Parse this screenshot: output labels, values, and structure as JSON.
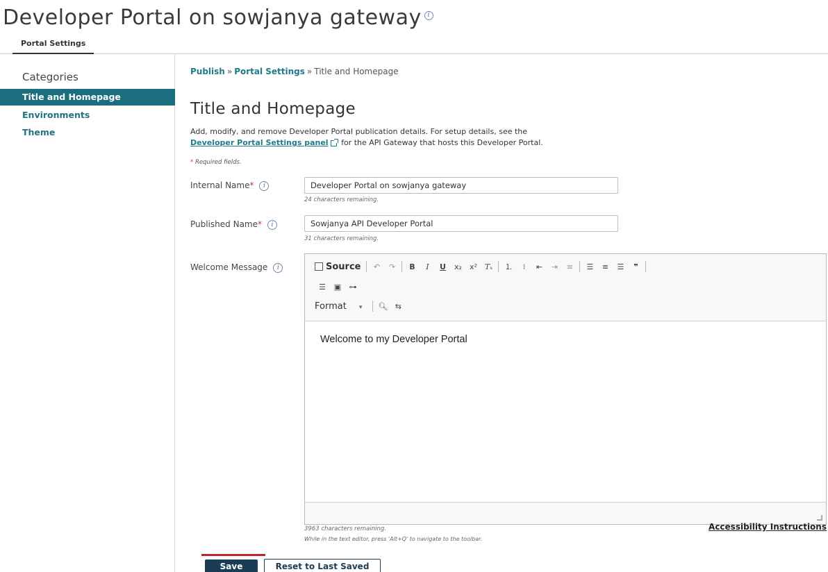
{
  "page": {
    "title": "Developer Portal on sowjanya gateway",
    "info_icon": "i"
  },
  "tabs": [
    {
      "label": "Portal Settings",
      "active": true
    }
  ],
  "sidebar": {
    "heading": "Categories",
    "items": [
      {
        "label": "Title and Homepage",
        "active": true
      },
      {
        "label": "Environments",
        "active": false
      },
      {
        "label": "Theme",
        "active": false
      }
    ]
  },
  "breadcrumb": {
    "items": [
      "Publish",
      "Portal Settings"
    ],
    "current": "Title and Homepage",
    "separator": "»"
  },
  "section": {
    "title": "Title and Homepage",
    "desc_part1": "Add, modify, and remove Developer Portal publication details. For setup details, see the",
    "desc_link": "Developer Portal Settings panel",
    "desc_part2": "for the API Gateway that hosts this Developer Portal.",
    "required_note": "Required fields."
  },
  "form": {
    "internal_name": {
      "label": "Internal Name",
      "value": "Developer Portal on sowjanya gateway",
      "hint": "24 characters remaining."
    },
    "published_name": {
      "label": "Published Name",
      "value": "Sowjanya API Developer Portal",
      "hint": "31 characters remaining."
    },
    "welcome_message": {
      "label": "Welcome Message",
      "content": "Welcome to my Developer Portal",
      "chars_remaining": "3963 characters remaining.",
      "alt_note": "While in the text editor, press 'Alt+Q' to navigate to the toolbar.",
      "accessibility_link": "Accessibility Instructions"
    }
  },
  "editor_toolbar": {
    "source_label": "Source",
    "format_label": "Format",
    "format_arrow": "▾",
    "row1_icons": [
      "undo-icon",
      "redo-icon",
      "bold-icon",
      "italic-icon",
      "underline-icon",
      "subscript-icon",
      "superscript-icon",
      "remove-format-icon",
      "numbered-list-icon",
      "bulleted-list-icon",
      "decrease-indent-icon",
      "increase-indent-icon",
      "align-left-icon",
      "align-center-icon",
      "align-right-icon",
      "blockquote-icon"
    ],
    "row2_icons": [
      "horizontal-line-icon",
      "image-icon",
      "link-icon"
    ],
    "row3_icons": [
      "find-icon",
      "replace-icon"
    ]
  },
  "buttons": {
    "save": "Save",
    "reset": "Reset to Last Saved"
  },
  "colors": {
    "accent": "#1b6e7e",
    "link": "#1f7a8a",
    "primary_button": "#1a3d55",
    "required": "#c0392b",
    "highlight_mark": "#c0252c"
  }
}
